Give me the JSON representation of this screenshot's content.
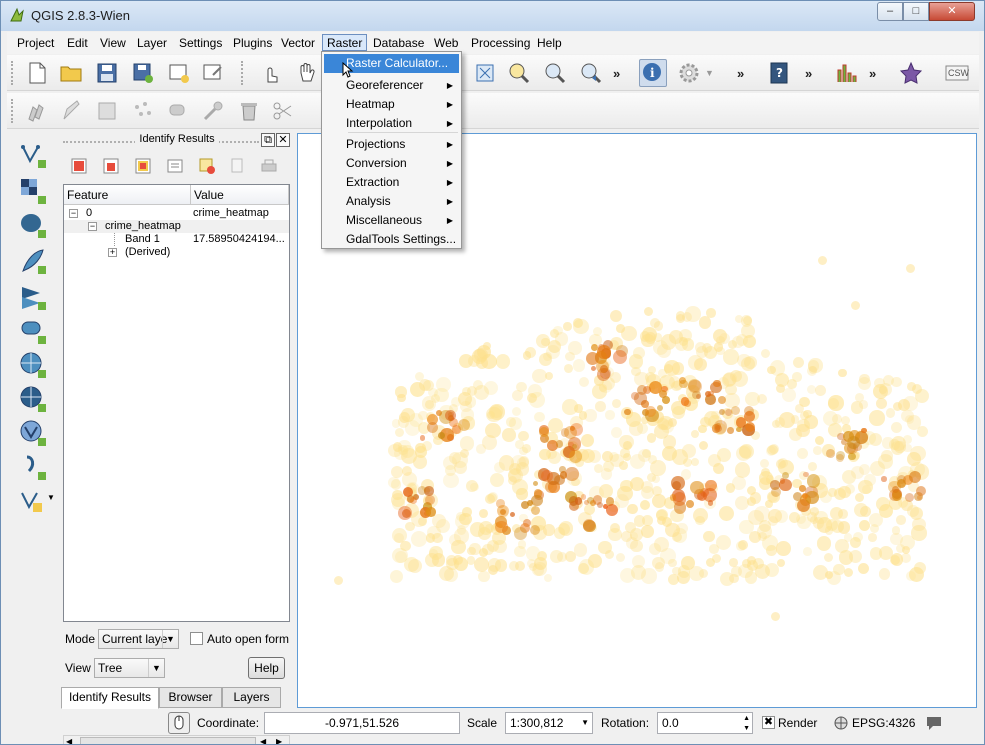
{
  "window": {
    "title": "QGIS 2.8.3-Wien"
  },
  "menubar": [
    "Project",
    "Edit",
    "View",
    "Layer",
    "Settings",
    "Plugins",
    "Vector",
    "Raster",
    "Database",
    "Web",
    "Processing",
    "Help"
  ],
  "raster_menu": {
    "items": [
      {
        "label": "Raster Calculator...",
        "submenu": false,
        "highlighted": true
      },
      {
        "label": "Georeferencer",
        "submenu": true
      },
      {
        "label": "Heatmap",
        "submenu": true
      },
      {
        "label": "Interpolation",
        "submenu": true
      },
      {
        "label": "Projections",
        "submenu": true
      },
      {
        "label": "Conversion",
        "submenu": true
      },
      {
        "label": "Extraction",
        "submenu": true
      },
      {
        "label": "Analysis",
        "submenu": true
      },
      {
        "label": "Miscellaneous",
        "submenu": true
      },
      {
        "label": "GdalTools Settings...",
        "submenu": false
      }
    ]
  },
  "toolbar": {
    "overflow": "»",
    "csw_label": "CSW"
  },
  "identify_panel": {
    "title": "Identify Results",
    "columns": [
      "Feature",
      "Value"
    ],
    "rows": [
      {
        "feature": "0",
        "value": "crime_heatmap"
      },
      {
        "feature": "crime_heatmap",
        "value": ""
      },
      {
        "feature": "Band 1",
        "value": "17.58950424194..."
      },
      {
        "feature": "(Derived)",
        "value": ""
      }
    ],
    "mode_label": "Mode",
    "mode_value": "Current laye",
    "auto_open_label": "Auto open form",
    "view_label": "View",
    "view_value": "Tree",
    "help_label": "Help",
    "tabs": [
      "Identify Results",
      "Browser",
      "Layers"
    ]
  },
  "statusbar": {
    "coordinate_label": "Coordinate:",
    "coordinate_value": "-0.971,51.526",
    "scale_label": "Scale",
    "scale_value": "1:300,812",
    "rotation_label": "Rotation:",
    "rotation_value": "0.0",
    "render_label": "Render",
    "crs": "EPSG:4326"
  },
  "colors": {
    "accent": "#3a86d8",
    "heat_low": "#fde9b0",
    "heat_high": "#b54a00"
  }
}
